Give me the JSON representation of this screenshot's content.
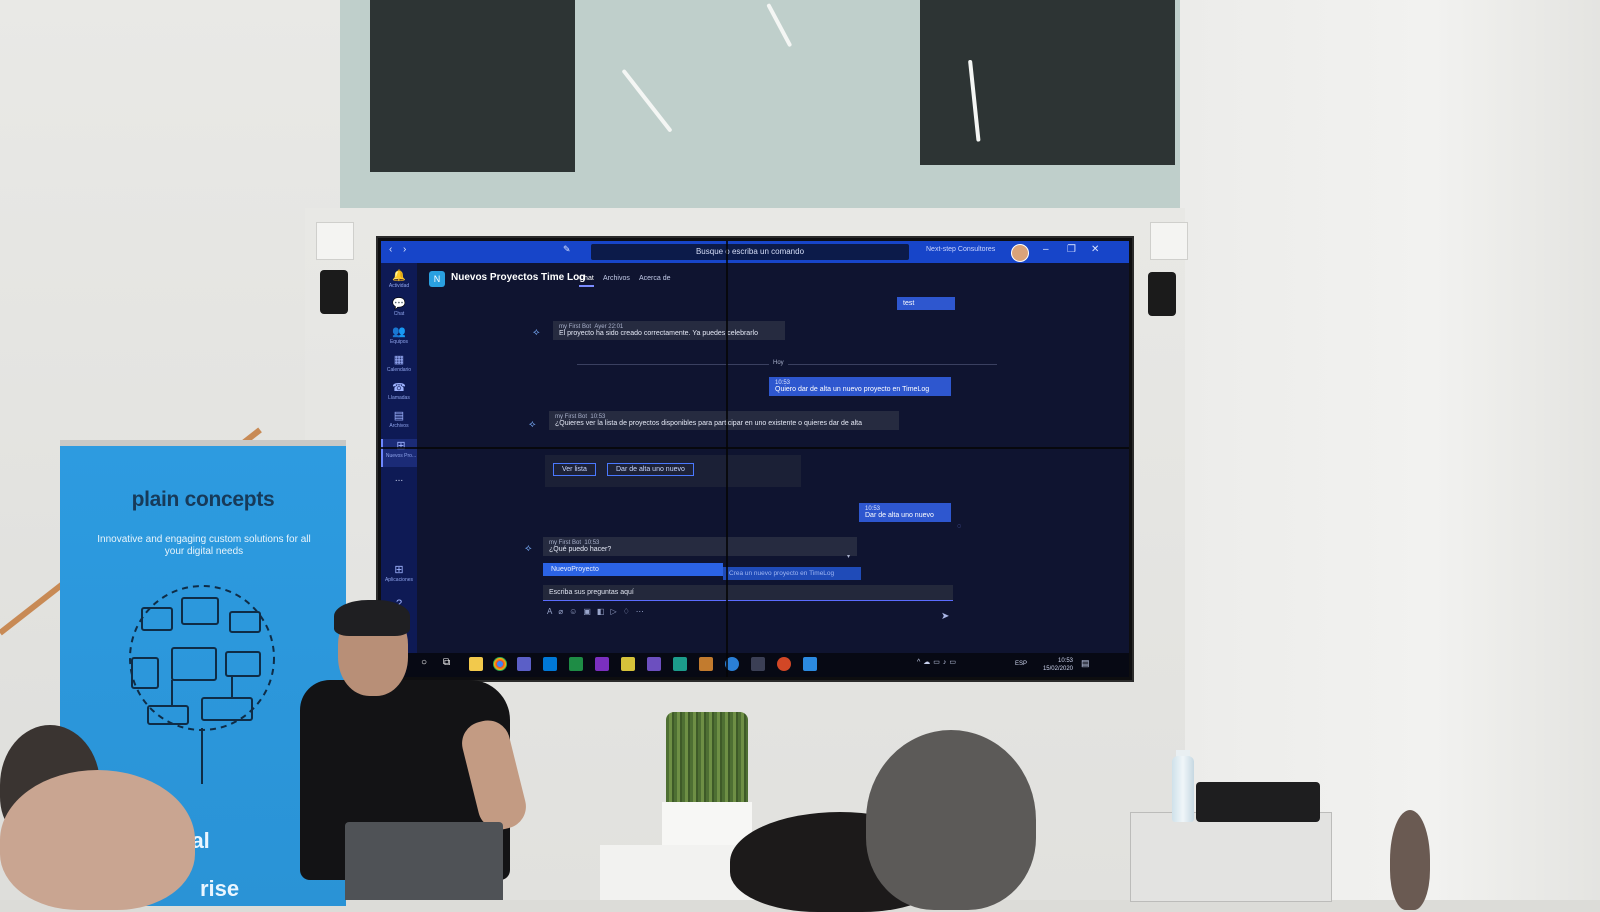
{
  "teams": {
    "search_placeholder": "Busque o escriba un comando",
    "org_name": "Next-step Consultores",
    "channel_title": "Nuevos Proyectos Time Log",
    "tabs": [
      "Chat",
      "Archivos",
      "Acerca de"
    ],
    "rail": [
      {
        "label": "Actividad",
        "icon": "bell-icon"
      },
      {
        "label": "Chat",
        "icon": "chat-icon"
      },
      {
        "label": "Equipos",
        "icon": "teams-icon"
      },
      {
        "label": "Calendario",
        "icon": "calendar-icon"
      },
      {
        "label": "Llamadas",
        "icon": "phone-icon"
      },
      {
        "label": "Archivos",
        "icon": "files-icon"
      },
      {
        "label": "Nuevos Pro...",
        "icon": "app-icon"
      },
      {
        "label": "...",
        "icon": "more-icon"
      },
      {
        "label": "Aplicaciones",
        "icon": "apps-icon"
      }
    ],
    "messages": {
      "test_msg": "test",
      "bot1_sender": "my First Bot",
      "bot1_time": "Ayer 22:01",
      "bot1_text": "El proyecto ha sido creado correctamente. Ya puedes celebrarlo",
      "divider": "Hoy",
      "user1_time": "10:53",
      "user1_text": "Quiero dar de alta un nuevo proyecto en TimeLog",
      "bot2_sender": "my First Bot",
      "bot2_time": "10:53",
      "bot2_text": "¿Quieres ver la lista de proyectos disponibles para participar en uno existente o quieres dar de alta",
      "bot2_btn1": "Ver lista",
      "bot2_btn2": "Dar de alta uno nuevo",
      "user2_time": "10:53",
      "user2_text": "Dar de alta uno nuevo",
      "bot3_sender": "my First Bot",
      "bot3_time": "10:53",
      "bot3_text": "¿Qué puedo hacer?",
      "suggestion": "NuevoProyecto",
      "suggestion_hint": "Crea un nuevo proyecto en TimeLog"
    },
    "composer_placeholder": "Escriba sus preguntas aquí",
    "taskbar": {
      "lang": "ESP",
      "time": "10:53",
      "date": "15/02/2020"
    }
  },
  "banner": {
    "brand": "plain concepts",
    "tagline": "Innovative and engaging custom solutions for all your digital needs",
    "partial_word_1": "ital",
    "partial_word_2": "rise"
  },
  "colors": {
    "teams_titlebar": "#1745c9",
    "teams_bg": "#0f1430",
    "banner_blue": "#2a93d6"
  }
}
